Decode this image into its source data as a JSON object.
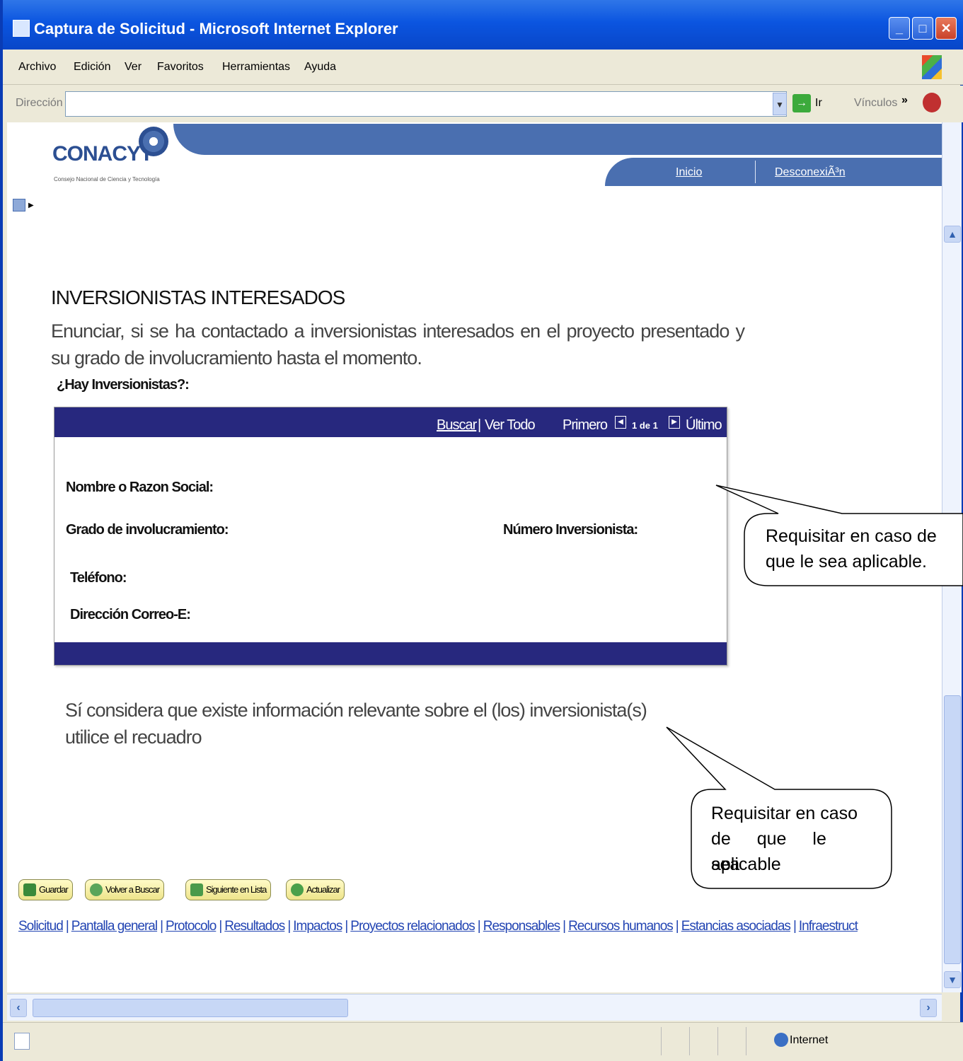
{
  "window": {
    "title": "Captura de Solicitud - Microsoft Internet Explorer"
  },
  "menu": [
    "Archivo",
    "Edición",
    "Ver",
    "Favoritos",
    "Herramientas",
    "Ayuda"
  ],
  "address": {
    "label": "Dirección",
    "value": "",
    "go_label": "Ir",
    "links_label": "Vínculos"
  },
  "header": {
    "logo": "CONACYT",
    "logo_sub": "Consejo Nacional de Ciencia y Tecnología",
    "nav_home": "Inicio",
    "nav_logout": "DesconexiÃ³n"
  },
  "section": {
    "title": "INVERSIONISTAS INTERESADOS",
    "description": "Enunciar, si se ha contactado a inversionistas interesados en el proyecto presentado y su grado de involucramiento hasta el momento.",
    "question": "¿Hay Inversionistas?:"
  },
  "grid": {
    "find": "Buscar",
    "view_all": "Ver Todo",
    "first": "Primero",
    "page": "1 de 1",
    "last": "Último",
    "fields": {
      "name": "Nombre o Razon Social:",
      "degree": "Grado de involucramiento:",
      "number": "Número Inversionista:",
      "phone": "Teléfono:",
      "email": "Dirección Correo-E:"
    }
  },
  "info_text": "Sí considera que existe información relevante sobre el (los) inversionista(s) utilice el recuadro",
  "buttons": {
    "save": "Guardar",
    "back": "Volver a Buscar",
    "next": "Siguiente en Lista",
    "refresh": "Actualizar"
  },
  "links": [
    "Solicitud",
    "Pantalla general",
    "Protocolo",
    "Resultados",
    "Impactos",
    "Proyectos relacionados",
    "Responsables",
    "Recursos humanos",
    "Estancias asociadas",
    "Infraestruct"
  ],
  "callouts": {
    "first": [
      "Requisitar en caso de",
      "que le sea aplicable."
    ],
    "second": [
      "Requisitar en caso",
      "de que le sea",
      "aplicable"
    ]
  },
  "status": {
    "zone": "Internet"
  }
}
